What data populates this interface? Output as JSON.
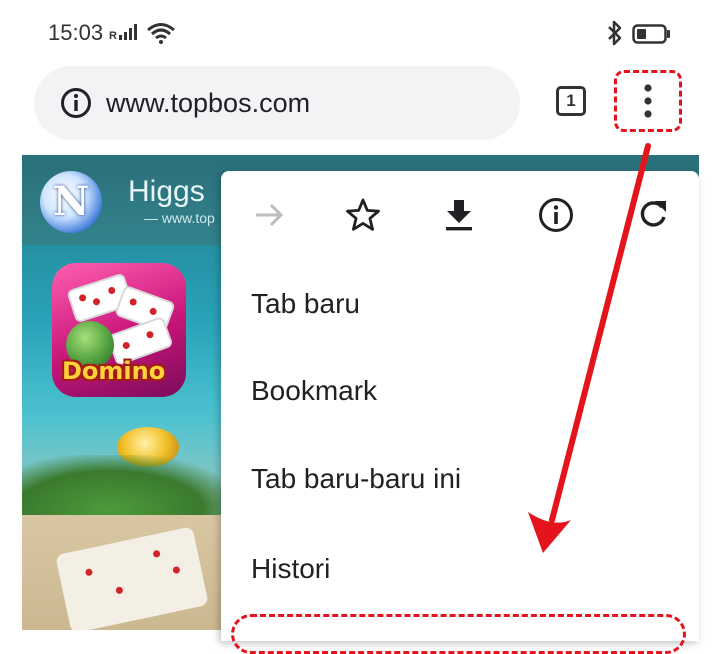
{
  "status_bar": {
    "time": "15:03",
    "signal_label": "R"
  },
  "browser": {
    "url": "www.topbos.com",
    "tab_count": "1"
  },
  "website": {
    "site_name": "Higgs",
    "site_url_partial": "www.top",
    "app_icon_text": "Domino",
    "logo_letter": "N"
  },
  "overflow_menu": {
    "icons": [
      "forward-icon",
      "bookmark-star-icon",
      "download-icon",
      "page-info-icon",
      "refresh-icon"
    ],
    "items": [
      {
        "label": "Tab baru"
      },
      {
        "label": "Bookmark"
      },
      {
        "label": "Tab baru-baru ini"
      },
      {
        "label": "Histori"
      }
    ]
  },
  "annotations": {
    "highlight_color": "#e3141b"
  }
}
